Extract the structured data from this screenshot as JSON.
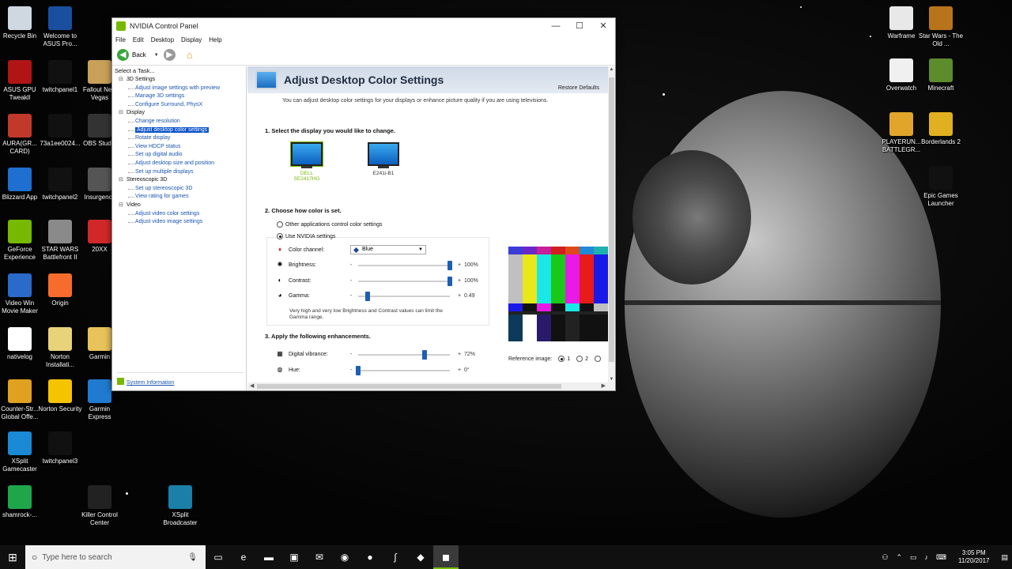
{
  "desktop": {
    "left_icons": [
      {
        "label": "Recycle Bin",
        "icon": "recycle-bin-icon",
        "color": "#cfd8e0"
      },
      {
        "label": "Welcome to ASUS Pro...",
        "icon": "asus-icon",
        "color": "#1a4fa0"
      },
      {
        "label": "ASUS GPU Tweakll",
        "icon": "asus-gpu-tweak-icon",
        "color": "#b01515"
      },
      {
        "label": "twitchpanel1",
        "icon": "blank-file-icon",
        "color": "#111111"
      },
      {
        "label": "Fallout New Vegas",
        "icon": "fallout-icon",
        "color": "#c8a05a"
      },
      {
        "label": "AURA(GR... CARD)",
        "icon": "aura-icon",
        "color": "#c0392b"
      },
      {
        "label": "73a1ee0024...",
        "icon": "blank-file-icon",
        "color": "#111111"
      },
      {
        "label": "OBS Studio",
        "icon": "obs-icon",
        "color": "#333333"
      },
      {
        "label": "Blizzard App",
        "icon": "blizzard-icon",
        "color": "#1e6fd0"
      },
      {
        "label": "twitchpanel2",
        "icon": "blank-file-icon",
        "color": "#111111"
      },
      {
        "label": "Insurgency",
        "icon": "insurgency-icon",
        "color": "#555555"
      },
      {
        "label": "GeForce Experience",
        "icon": "geforce-icon",
        "color": "#76b900"
      },
      {
        "label": "STAR WARS Battlefront II",
        "icon": "battlefront-icon",
        "color": "#8a8a8a"
      },
      {
        "label": "20XX",
        "icon": "20xx-icon",
        "color": "#d02828"
      },
      {
        "label": "Video Win Movie Maker",
        "icon": "movie-maker-icon",
        "color": "#2a6ac8"
      },
      {
        "label": "Origin",
        "icon": "origin-icon",
        "color": "#f56c2d"
      },
      {
        "label": "nativelog",
        "icon": "text-file-icon",
        "color": "#ffffff"
      },
      {
        "label": "Norton Installati...",
        "icon": "norton-installer-icon",
        "color": "#e8d27a"
      },
      {
        "label": "Garmin",
        "icon": "folder-icon",
        "color": "#e8c25a"
      },
      {
        "label": "Counter-Str... Global Offe...",
        "icon": "csgo-icon",
        "color": "#e0a020"
      },
      {
        "label": "Norton Security",
        "icon": "norton-icon",
        "color": "#f5c400"
      },
      {
        "label": "Garmin Express",
        "icon": "garmin-express-icon",
        "color": "#1f7ad0"
      },
      {
        "label": "XSplit Gamecaster",
        "icon": "xsplit-gamecaster-icon",
        "color": "#1a8ad4"
      },
      {
        "label": "twitchpanel3",
        "icon": "blank-file-icon",
        "color": "#111111"
      },
      {
        "label": "shamrock-...",
        "icon": "shamrock-icon",
        "color": "#1fa64a"
      },
      {
        "label": "Killer Control Center",
        "icon": "killer-icon",
        "color": "#222222"
      },
      {
        "label": "XSplit Broadcaster",
        "icon": "xsplit-broadcaster-icon",
        "color": "#1b7fa8"
      }
    ],
    "right_icons": [
      {
        "label": "Warframe",
        "icon": "warframe-icon",
        "color": "#e8e8e8"
      },
      {
        "label": "Star Wars - The Old ...",
        "icon": "swtor-icon",
        "color": "#b8741a"
      },
      {
        "label": "Overwatch",
        "icon": "overwatch-icon",
        "color": "#f0f0f0"
      },
      {
        "label": "Minecraft",
        "icon": "minecraft-icon",
        "color": "#5c8c2c"
      },
      {
        "label": "PLAYERUN... BATTLEGR...",
        "icon": "pubg-icon",
        "color": "#e0a52a"
      },
      {
        "label": "Borderlands 2",
        "icon": "borderlands-icon",
        "color": "#e0b020"
      },
      {
        "label": "Epic Games Launcher",
        "icon": "epic-games-icon",
        "color": "#111111"
      }
    ]
  },
  "window": {
    "title": "NVIDIA Control Panel",
    "controls": {
      "minimize": "—",
      "maximize": "☐",
      "close": "✕"
    },
    "menu": [
      "File",
      "Edit",
      "Desktop",
      "Display",
      "Help"
    ],
    "toolbar": {
      "back_label": "Back"
    }
  },
  "sidebar": {
    "header": "Select a Task...",
    "tree": [
      {
        "type": "cat",
        "label": "3D Settings"
      },
      {
        "type": "item",
        "label": "Adjust image settings with preview"
      },
      {
        "type": "item",
        "label": "Manage 3D settings"
      },
      {
        "type": "item",
        "label": "Configure Surround, PhysX"
      },
      {
        "type": "cat",
        "label": "Display"
      },
      {
        "type": "item",
        "label": "Change resolution"
      },
      {
        "type": "item",
        "label": "Adjust desktop color settings",
        "selected": true
      },
      {
        "type": "item",
        "label": "Rotate display"
      },
      {
        "type": "item",
        "label": "View HDCP status"
      },
      {
        "type": "item",
        "label": "Set up digital audio"
      },
      {
        "type": "item",
        "label": "Adjust desktop size and position"
      },
      {
        "type": "item",
        "label": "Set up multiple displays"
      },
      {
        "type": "cat",
        "label": "Stereoscopic 3D"
      },
      {
        "type": "item",
        "label": "Set up stereoscopic 3D"
      },
      {
        "type": "item",
        "label": "View rating for games"
      },
      {
        "type": "cat",
        "label": "Video"
      },
      {
        "type": "item",
        "label": "Adjust video color settings"
      },
      {
        "type": "item",
        "label": "Adjust video image settings"
      }
    ],
    "system_info": "System Information"
  },
  "content": {
    "title": "Adjust Desktop Color Settings",
    "restore": "Restore Defaults",
    "intro": "You can adjust desktop color settings for your displays or enhance picture quality if you are using televisions.",
    "step1": "1. Select the display you would like to change.",
    "displays": [
      {
        "name": "DELL SE2417HG",
        "selected": true
      },
      {
        "name": "E241i-B1",
        "selected": false
      }
    ],
    "step2": "2. Choose how color is set.",
    "radio_other": "Other applications control color settings",
    "radio_nvidia": "Use NVIDIA settings",
    "color_channel_label": "Color channel:",
    "color_channel_value": "Blue",
    "minus_sign": "-",
    "plus_sign": "+",
    "sliders": [
      {
        "label": "Brightness:",
        "icon": "brightness-icon",
        "value": "100%",
        "fraction": 1.0
      },
      {
        "label": "Contrast:",
        "icon": "contrast-icon",
        "value": "100%",
        "fraction": 1.0
      },
      {
        "label": "Gamma:",
        "icon": "gamma-icon",
        "value": "0.49",
        "fraction": 0.1
      }
    ],
    "note": "Very high and very low Brightness and Contrast values can limit the Gamma range.",
    "step3": "3. Apply the following enhancements.",
    "enhancements": [
      {
        "label": "Digital vibrance:",
        "icon": "vibrance-icon",
        "value": "72%",
        "fraction": 0.72
      },
      {
        "label": "Hue:",
        "icon": "hue-icon",
        "value": "0°",
        "fraction": 0.0
      }
    ],
    "reference_label": "Reference image:",
    "reference_options": [
      "1",
      "2",
      "3"
    ]
  },
  "taskbar": {
    "search_placeholder": "Type here to search",
    "time": "3:05 PM",
    "date": "11/20/2017",
    "apps": [
      {
        "name": "task-view-icon",
        "glyph": "▭"
      },
      {
        "name": "edge-icon",
        "glyph": "e"
      },
      {
        "name": "file-explorer-icon",
        "glyph": "▬"
      },
      {
        "name": "store-icon",
        "glyph": "▣"
      },
      {
        "name": "mail-icon",
        "glyph": "✉"
      },
      {
        "name": "discord-icon",
        "glyph": "◉"
      },
      {
        "name": "origin-icon",
        "glyph": "●"
      },
      {
        "name": "steam-icon",
        "glyph": "∫"
      },
      {
        "name": "app-red-icon",
        "glyph": "◆"
      },
      {
        "name": "nvidia-icon",
        "glyph": "◼",
        "active": true
      }
    ]
  }
}
